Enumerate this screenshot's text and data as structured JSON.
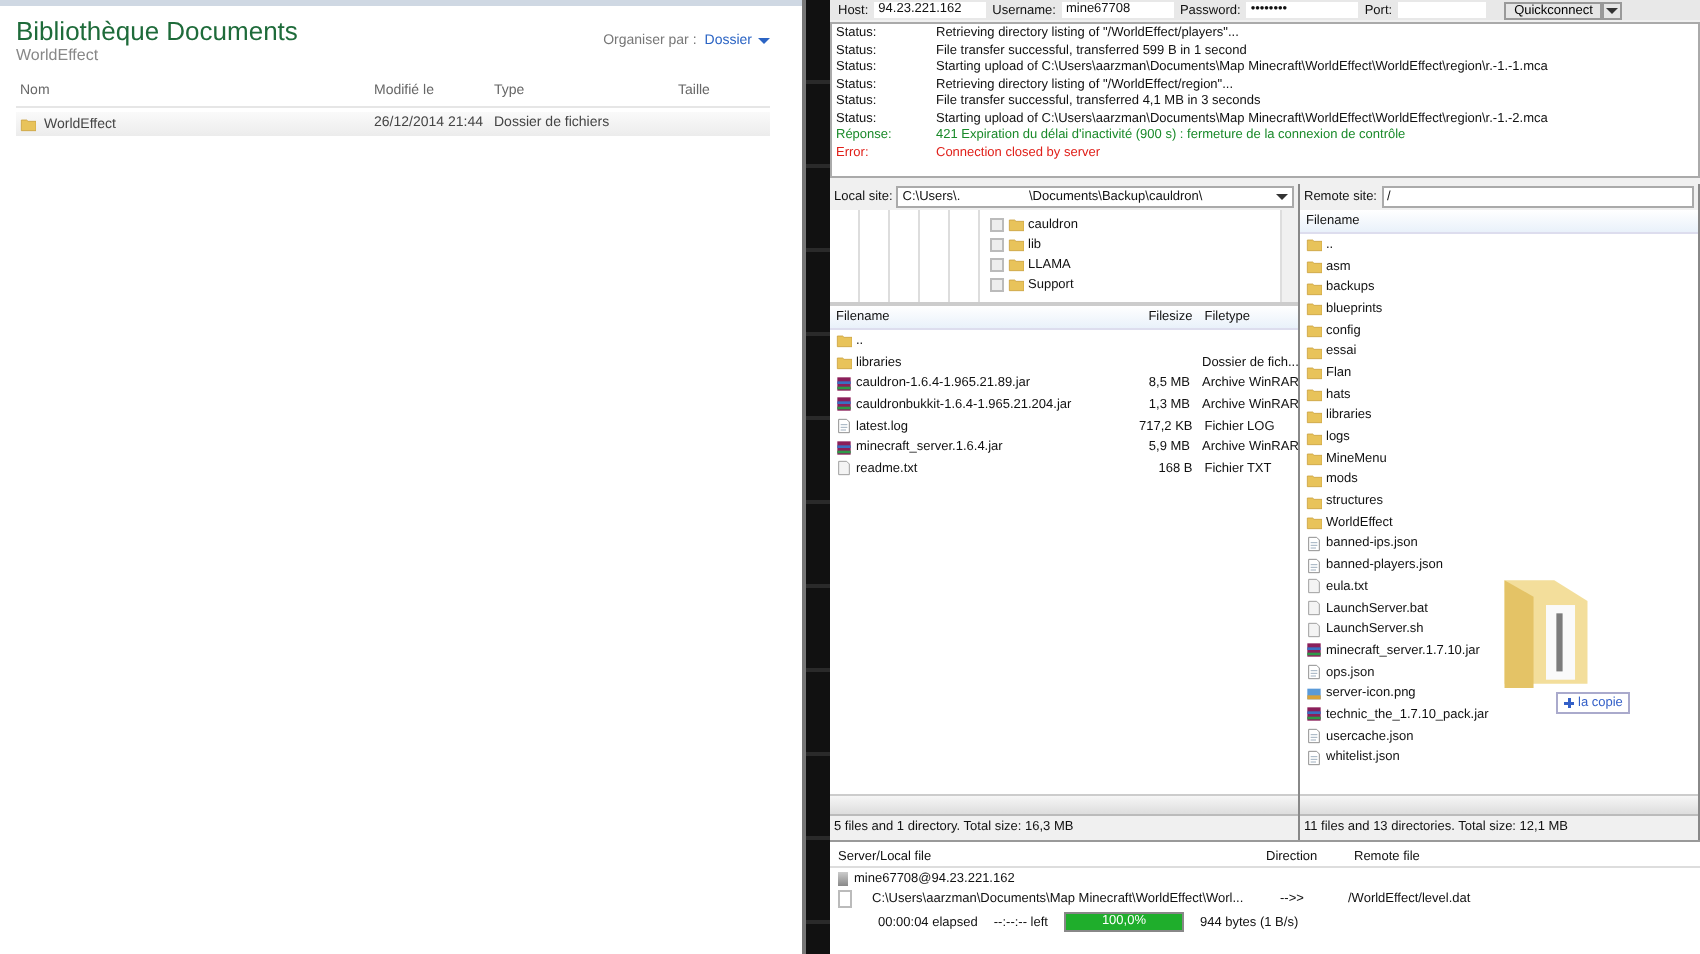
{
  "explorer": {
    "title": "Bibliothèque Documents",
    "subtitle": "WorldEffect",
    "organize_label": "Organiser par :",
    "organize_value": "Dossier",
    "columns": [
      "Nom",
      "Modifié le",
      "Type",
      "Taille"
    ],
    "rows": [
      {
        "name": "WorldEffect",
        "modified": "26/12/2014 21:44",
        "type": "Dossier de fichiers"
      }
    ]
  },
  "connect_bar": {
    "host_label": "Host:",
    "host": "94.23.221.162",
    "username_label": "Username:",
    "username": "mine67708",
    "password_label": "Password:",
    "password": "••••••••",
    "port_label": "Port:",
    "quickconnect": "Quickconnect"
  },
  "log": [
    {
      "kind": "status",
      "label": "Status:",
      "text": "Retrieving directory listing of \"/WorldEffect/players\"..."
    },
    {
      "kind": "status",
      "label": "Status:",
      "text": "File transfer successful, transferred 599 B in 1 second"
    },
    {
      "kind": "status",
      "label": "Status:",
      "text": "Starting upload of C:\\Users\\aarzman\\Documents\\Map Minecraft\\WorldEffect\\WorldEffect\\region\\r.-1.-1.mca"
    },
    {
      "kind": "status",
      "label": "Status:",
      "text": "Retrieving directory listing of \"/WorldEffect/region\"..."
    },
    {
      "kind": "status",
      "label": "Status:",
      "text": "File transfer successful, transferred 4,1 MB in 3 seconds"
    },
    {
      "kind": "status",
      "label": "Status:",
      "text": "Starting upload of C:\\Users\\aarzman\\Documents\\Map Minecraft\\WorldEffect\\WorldEffect\\region\\r.-1.-2.mca"
    },
    {
      "kind": "response",
      "label": "Réponse:",
      "text": "421 Expiration du délai d'inactivité (900 s) : fermeture de la connexion de contrôle"
    },
    {
      "kind": "error",
      "label": "Error:",
      "text": "Connection closed by server"
    }
  ],
  "local": {
    "label": "Local site:",
    "path": "C:\\Users\\.                   \\Documents\\Backup\\cauldron\\",
    "tree": [
      "cauldron",
      "lib",
      "LLAMA",
      "Support"
    ],
    "columns": [
      "Filename",
      "Filesize",
      "Filetype"
    ],
    "rows": [
      {
        "kind": "folder",
        "name": "..",
        "size": "",
        "filetype": ""
      },
      {
        "kind": "folder",
        "name": "libraries",
        "size": "",
        "filetype": "Dossier de fich..."
      },
      {
        "kind": "archive",
        "name": "cauldron-1.6.4-1.965.21.89.jar",
        "size": "8,5 MB",
        "filetype": "Archive WinRAR"
      },
      {
        "kind": "archive",
        "name": "cauldronbukkit-1.6.4-1.965.21.204.jar",
        "size": "1,3 MB",
        "filetype": "Archive WinRAR"
      },
      {
        "kind": "document",
        "name": "latest.log",
        "size": "717,2 KB",
        "filetype": "Fichier LOG"
      },
      {
        "kind": "archive",
        "name": "minecraft_server.1.6.4.jar",
        "size": "5,9 MB",
        "filetype": "Archive WinRAR"
      },
      {
        "kind": "blank",
        "name": "readme.txt",
        "size": "168 B",
        "filetype": "Fichier TXT"
      }
    ],
    "status": "5 files and 1 directory. Total size: 16,3 MB"
  },
  "remote": {
    "label": "Remote site:",
    "path": "/",
    "columns": [
      "Filename"
    ],
    "rows": [
      {
        "kind": "folder",
        "name": ".."
      },
      {
        "kind": "folder",
        "name": "asm"
      },
      {
        "kind": "folder",
        "name": "backups"
      },
      {
        "kind": "folder",
        "name": "blueprints"
      },
      {
        "kind": "folder",
        "name": "config"
      },
      {
        "kind": "folder",
        "name": "essai"
      },
      {
        "kind": "folder",
        "name": "Flan"
      },
      {
        "kind": "folder",
        "name": "hats"
      },
      {
        "kind": "folder",
        "name": "libraries"
      },
      {
        "kind": "folder",
        "name": "logs"
      },
      {
        "kind": "folder",
        "name": "MineMenu"
      },
      {
        "kind": "folder",
        "name": "mods"
      },
      {
        "kind": "folder",
        "name": "structures"
      },
      {
        "kind": "folder",
        "name": "WorldEffect"
      },
      {
        "kind": "document",
        "name": "banned-ips.json"
      },
      {
        "kind": "document",
        "name": "banned-players.json"
      },
      {
        "kind": "blank",
        "name": "eula.txt"
      },
      {
        "kind": "blank",
        "name": "LaunchServer.bat"
      },
      {
        "kind": "blank",
        "name": "LaunchServer.sh"
      },
      {
        "kind": "archive",
        "name": "minecraft_server.1.7.10.jar"
      },
      {
        "kind": "document",
        "name": "ops.json"
      },
      {
        "kind": "image",
        "name": "server-icon.png"
      },
      {
        "kind": "archive",
        "name": "technic_the_1.7.10_pack.jar"
      },
      {
        "kind": "document",
        "name": "usercache.json"
      },
      {
        "kind": "document",
        "name": "whitelist.json"
      }
    ],
    "status": "11 files and 13 directories. Total size: 12,1 MB"
  },
  "drag_tooltip": {
    "text": "la copie"
  },
  "queue": {
    "columns": [
      "Server/Local file",
      "Direction",
      "Remote file"
    ],
    "server": "mine67708@94.23.221.162",
    "items": [
      {
        "local": "C:\\Users\\aarzman\\Documents\\Map Minecraft\\WorldEffect\\Worl...",
        "direction": "-->>",
        "remote": "/WorldEffect/level.dat",
        "elapsed": "00:00:04 elapsed",
        "left": "--:--:-- left",
        "level": 1,
        "progress_text": "100,0%",
        "transferred": "944 bytes (1 B/s)"
      }
    ]
  }
}
